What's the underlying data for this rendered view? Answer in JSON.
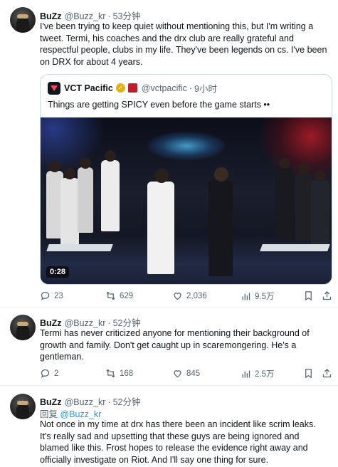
{
  "tweets": [
    {
      "name": "BuZz",
      "handle": "@Buzz_kr",
      "time": "53分钟",
      "text": "I've been trying to keep quiet without mentioning this, but I'm writing a tweet. Termi, his coaches and the drx club are really grateful and respectful people, clubs in my life. They've been legends on cs. I've been on DRX for about 4 years.",
      "quote": {
        "name": "VCT Pacific",
        "handle": "@vctpacific",
        "time": "9小时",
        "text": "Things are getting SPICY even before the game starts ••",
        "video_duration": "0:28"
      },
      "stats": {
        "replies": "23",
        "retweets": "629",
        "likes": "2,036",
        "views": "9.5万"
      }
    },
    {
      "name": "BuZz",
      "handle": "@Buzz_kr",
      "time": "52分钟",
      "text": "Termi has never criticized anyone for mentioning their background of growth and family. Don't get caught up in scaremongering. He's a gentleman.",
      "stats": {
        "replies": "2",
        "retweets": "168",
        "likes": "845",
        "views": "2.5万"
      }
    },
    {
      "name": "BuZz",
      "handle": "@Buzz_kr",
      "time": "52分钟",
      "reply_label": "回复",
      "reply_mention": "@Buzz_kr",
      "text": "Not once in my time at drx has there been an incident like scrim leaks. It's really sad and upsetting that these guys are being ignored and blamed like this. Frost hopes to release the evidence right away and officially investigate on Riot. And I'll say one thing for sure."
    }
  ],
  "separator": "·",
  "icons": {
    "reply": "reply-icon",
    "retweet": "retweet-icon",
    "like": "heart-icon",
    "views": "views-icon",
    "bookmark": "bookmark-icon",
    "share": "share-icon"
  },
  "colors": {
    "text": "#0f1419",
    "muted": "#536471",
    "link": "#1d9bf0",
    "border": "#cfd9de"
  }
}
